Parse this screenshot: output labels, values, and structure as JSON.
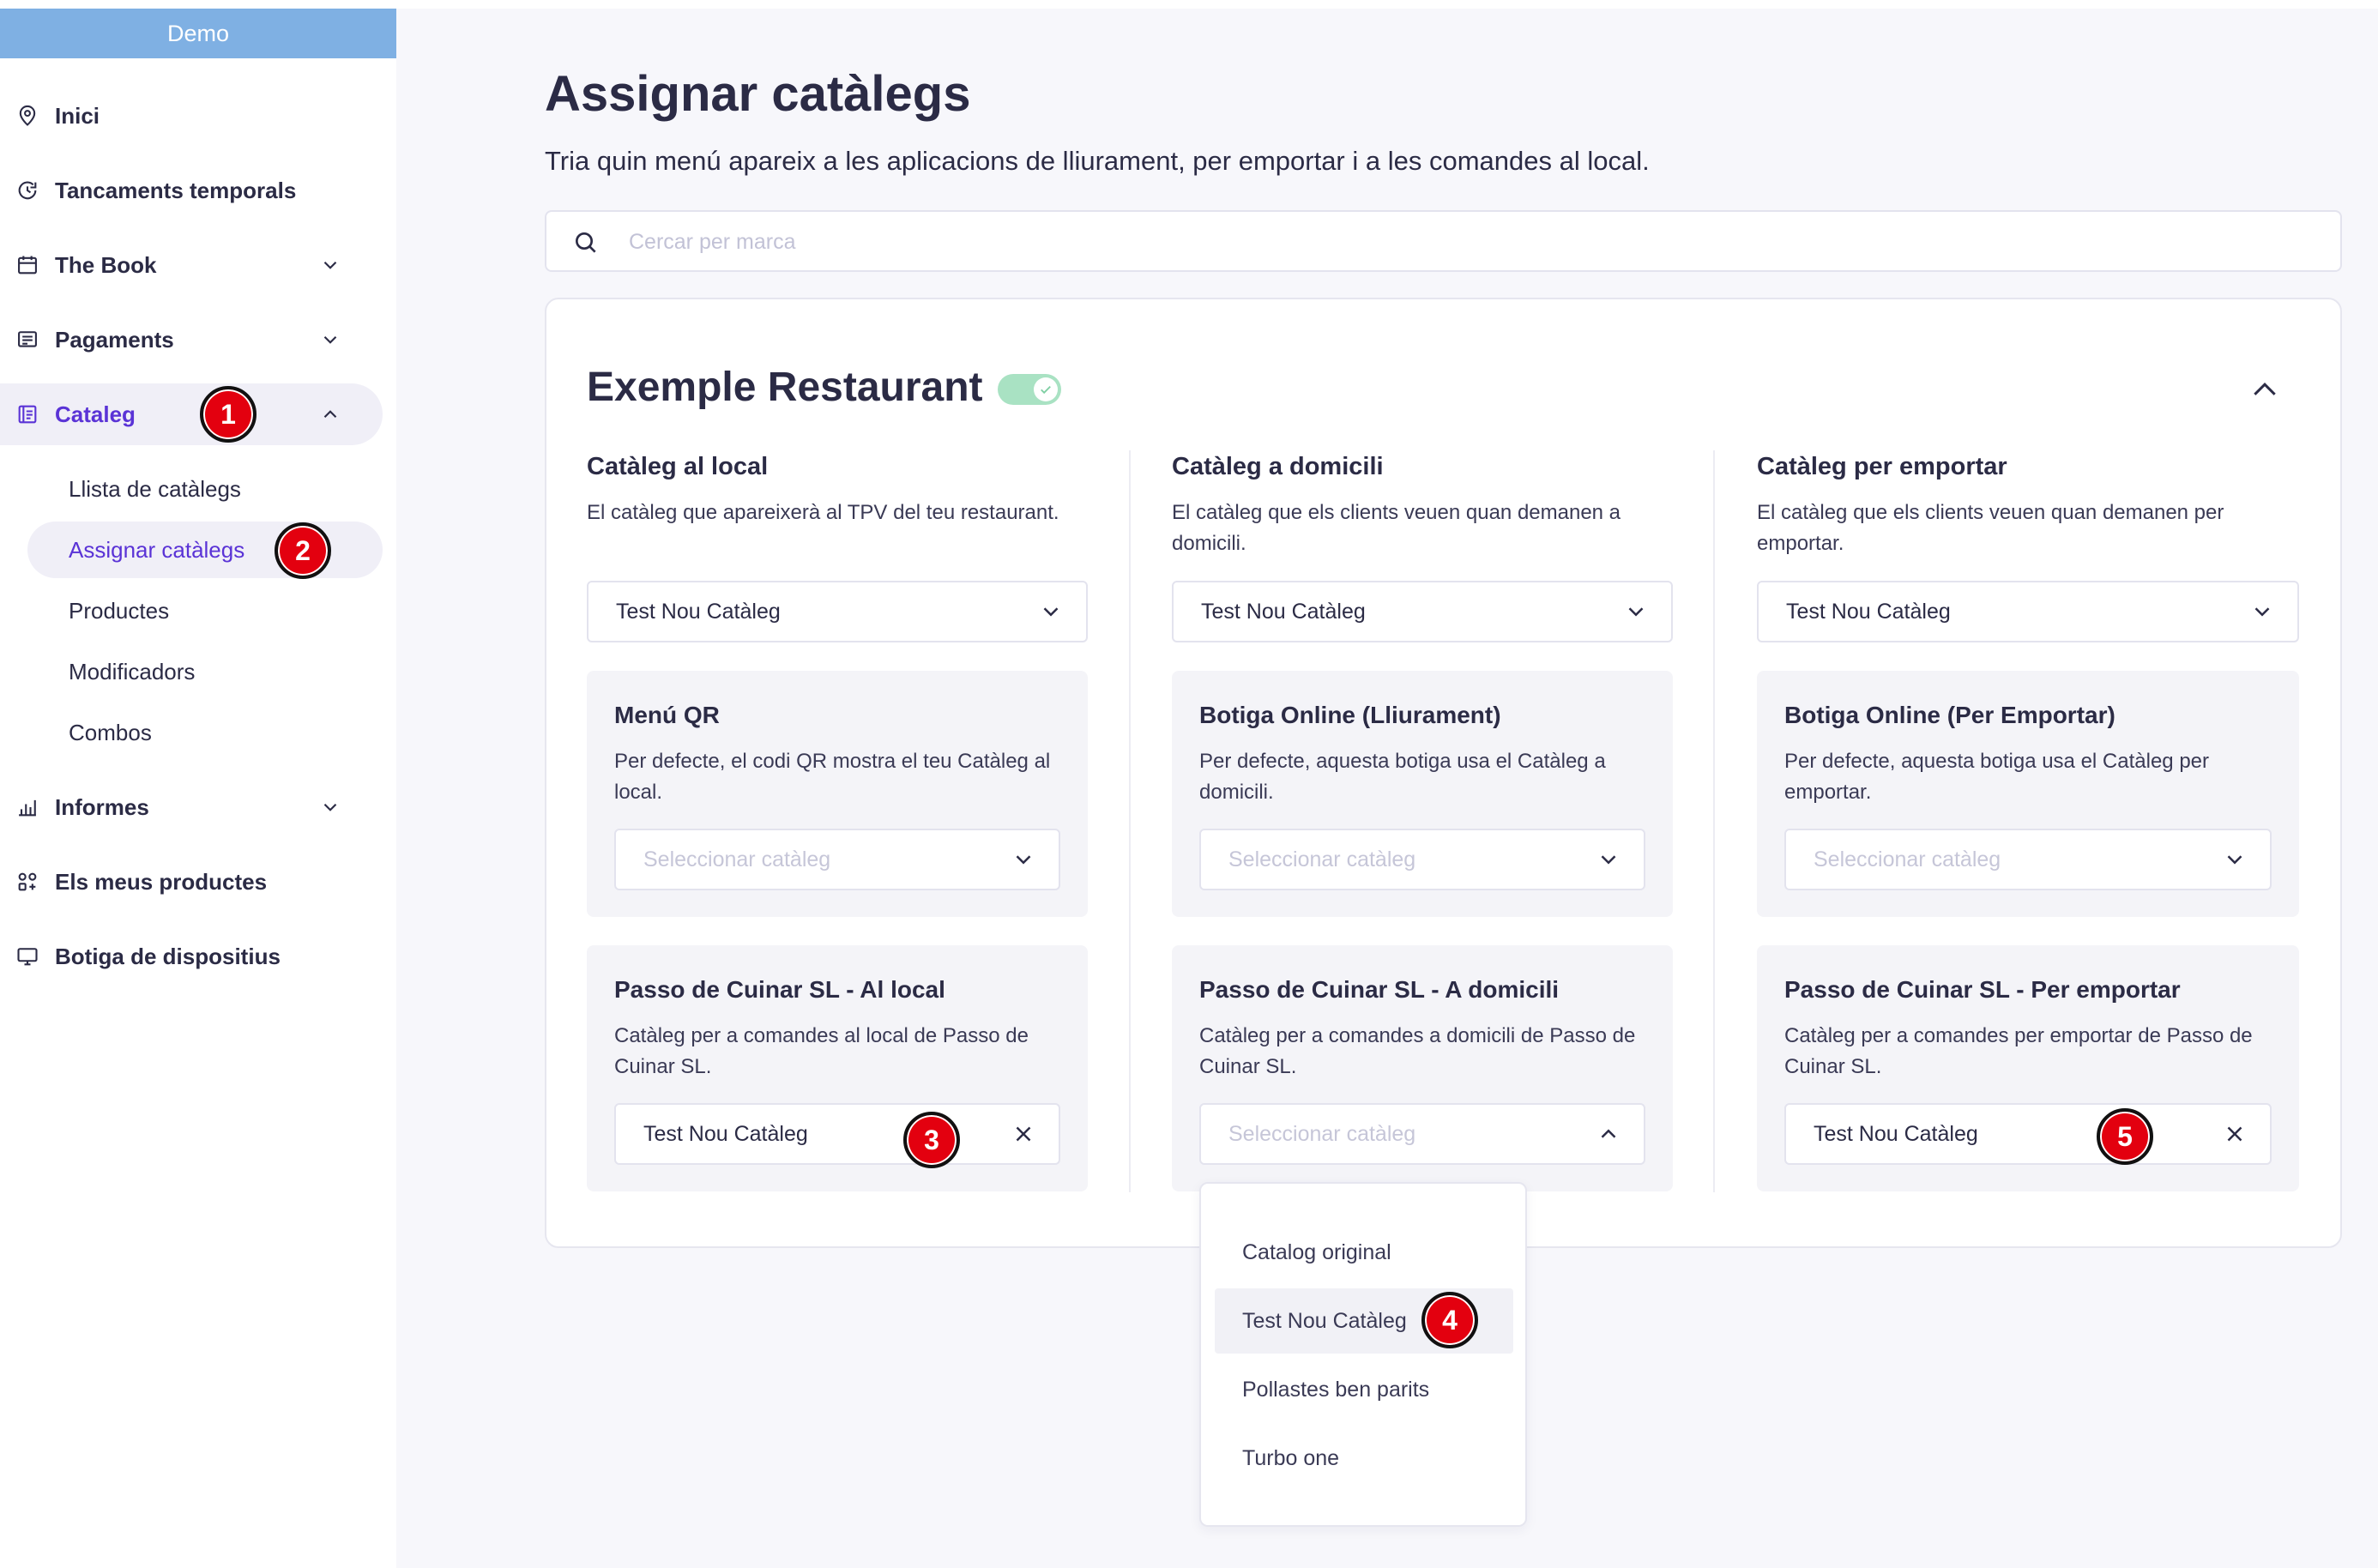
{
  "app": {
    "workspace": "Demo"
  },
  "sidebar": {
    "items": [
      {
        "label": "Inici",
        "icon": "location-pin-icon"
      },
      {
        "label": "Tancaments temporals",
        "icon": "clock-refresh-icon"
      },
      {
        "label": "The Book",
        "icon": "calendar-icon",
        "expandable": true
      },
      {
        "label": "Pagaments",
        "icon": "receipt-icon",
        "expandable": true
      },
      {
        "label": "Cataleg",
        "icon": "catalog-icon",
        "expandable": true,
        "expanded": true,
        "active": true
      },
      {
        "label": "Informes",
        "icon": "bar-chart-icon",
        "expandable": true
      },
      {
        "label": "Els meus productes",
        "icon": "grid-shapes-icon"
      },
      {
        "label": "Botiga de dispositius",
        "icon": "monitor-icon"
      }
    ],
    "cataleg_sub": [
      {
        "label": "Llista de catàlegs"
      },
      {
        "label": "Assignar catàlegs",
        "active": true
      },
      {
        "label": "Productes"
      },
      {
        "label": "Modificadors"
      },
      {
        "label": "Combos"
      }
    ]
  },
  "header": {
    "title": "Assignar catàlegs",
    "subtitle": "Tria quin menú apareix a les aplicacions de lliurament, per emportar i a les comandes al local."
  },
  "search": {
    "placeholder": "Cercar per marca",
    "value": ""
  },
  "restaurant": {
    "name": "Exemple Restaurant",
    "enabled": true,
    "columns": [
      {
        "title": "Catàleg al local",
        "description": "El catàleg que apareixerà al TPV del teu restaurant.",
        "selected": "Test Nou Catàleg",
        "panels": [
          {
            "title": "Menú QR",
            "description": "Per defecte, el codi QR mostra el teu Catàleg al local.",
            "value": "",
            "placeholder": "Seleccionar catàleg"
          },
          {
            "title": "Passo de Cuinar SL - Al local",
            "description": "Catàleg per a comandes al local de Passo de Cuinar SL.",
            "value": "Test Nou Catàleg",
            "placeholder": "Seleccionar catàleg"
          }
        ]
      },
      {
        "title": "Catàleg a domicili",
        "description": "El catàleg que els clients veuen quan demanen a domicili.",
        "selected": "Test Nou Catàleg",
        "panels": [
          {
            "title": "Botiga Online (Lliurament)",
            "description": "Per defecte, aquesta botiga usa el Catàleg a domicili.",
            "value": "",
            "placeholder": "Seleccionar catàleg"
          },
          {
            "title": "Passo de Cuinar SL - A domicili",
            "description": "Catàleg per a comandes a domicili de Passo de Cuinar SL.",
            "value": "",
            "placeholder": "Seleccionar catàleg",
            "open": true
          }
        ]
      },
      {
        "title": "Catàleg per emportar",
        "description": "El catàleg que els clients veuen quan demanen per emportar.",
        "selected": "Test Nou Catàleg",
        "panels": [
          {
            "title": "Botiga Online (Per Emportar)",
            "description": "Per defecte, aquesta botiga usa el Catàleg per emportar.",
            "value": "",
            "placeholder": "Seleccionar catàleg"
          },
          {
            "title": "Passo de Cuinar SL - Per emportar",
            "description": "Catàleg per a comandes per emportar de Passo de Cuinar SL.",
            "value": "Test Nou Catàleg",
            "placeholder": "Seleccionar catàleg"
          }
        ]
      }
    ]
  },
  "dropdown": {
    "options": [
      "Catalog original",
      "Test Nou Catàleg",
      "Pollastes ben parits",
      "Turbo one"
    ],
    "highlighted_index": 1
  },
  "markers": [
    "1",
    "2",
    "3",
    "4",
    "5"
  ],
  "colors": {
    "accent": "#5a33d6",
    "demo_bar": "#7fb0e3",
    "toggle_on": "#a9e2c3",
    "marker": "#e3000f"
  }
}
